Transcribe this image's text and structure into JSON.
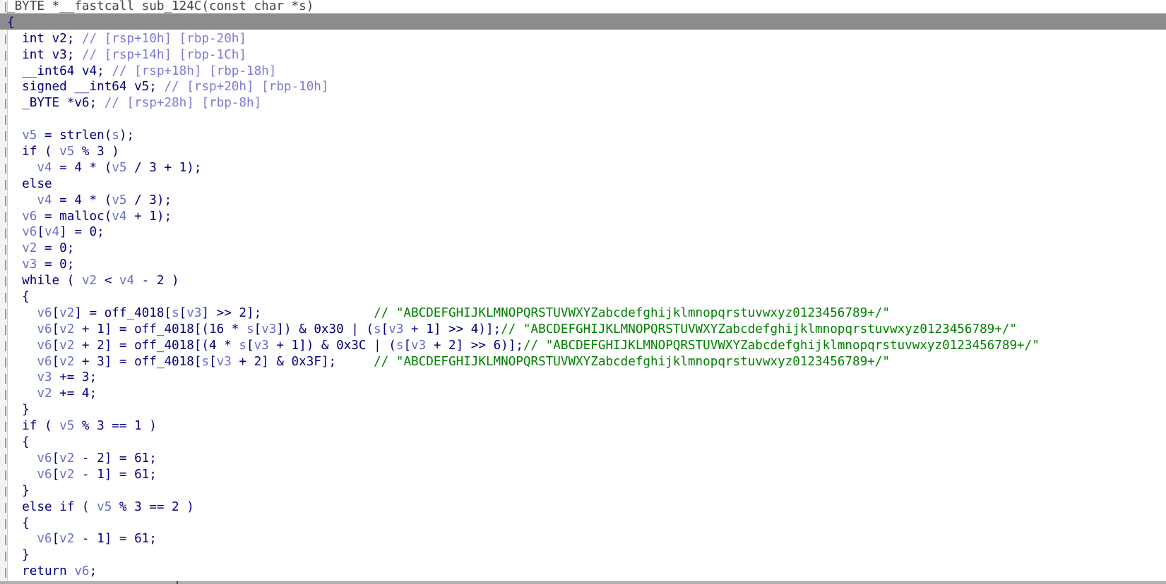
{
  "window": {
    "view": "pseudocode"
  },
  "colors": {
    "keyword": "#000080",
    "variable": "#6670c8",
    "offset_comment": "#7b7bd9",
    "string_comment": "#008000",
    "current_line_bg": "#8c8c8c"
  },
  "code_lines": [
    [
      {
        "t": "_BYTE *__fastcall sub_124C(const char *s)",
        "c": "header"
      }
    ],
    [
      {
        "t": "{",
        "c": "brace-cur"
      }
    ],
    [
      {
        "t": "  int ",
        "c": "kw"
      },
      {
        "t": "v2",
        "c": "kw"
      },
      {
        "t": "; ",
        "c": "punc"
      },
      {
        "t": "// [rsp+10h] [rbp-20h]",
        "c": "comment"
      }
    ],
    [
      {
        "t": "  int ",
        "c": "kw"
      },
      {
        "t": "v3",
        "c": "kw"
      },
      {
        "t": "; ",
        "c": "punc"
      },
      {
        "t": "// [rsp+14h] [rbp-1Ch]",
        "c": "comment"
      }
    ],
    [
      {
        "t": "  __int64 ",
        "c": "kw"
      },
      {
        "t": "v4",
        "c": "kw"
      },
      {
        "t": "; ",
        "c": "punc"
      },
      {
        "t": "// [rsp+18h] [rbp-18h]",
        "c": "comment"
      }
    ],
    [
      {
        "t": "  signed __int64 ",
        "c": "kw"
      },
      {
        "t": "v5",
        "c": "kw"
      },
      {
        "t": "; ",
        "c": "punc"
      },
      {
        "t": "// [rsp+20h] [rbp-10h]",
        "c": "comment"
      }
    ],
    [
      {
        "t": "  _BYTE *",
        "c": "kw"
      },
      {
        "t": "v6",
        "c": "kw"
      },
      {
        "t": "; ",
        "c": "punc"
      },
      {
        "t": "// [rsp+28h] [rbp-8h]",
        "c": "comment"
      }
    ],
    [
      {
        "t": "",
        "c": "punc"
      }
    ],
    [
      {
        "t": "  ",
        "c": "punc"
      },
      {
        "t": "v5",
        "c": "var"
      },
      {
        "t": " = ",
        "c": "punc"
      },
      {
        "t": "strlen",
        "c": "fn"
      },
      {
        "t": "(",
        "c": "punc"
      },
      {
        "t": "s",
        "c": "var"
      },
      {
        "t": ");",
        "c": "punc"
      }
    ],
    [
      {
        "t": "  if ( ",
        "c": "kw"
      },
      {
        "t": "v5",
        "c": "var"
      },
      {
        "t": " % 3 )",
        "c": "punc"
      }
    ],
    [
      {
        "t": "    ",
        "c": "punc"
      },
      {
        "t": "v4",
        "c": "var"
      },
      {
        "t": " = 4 * (",
        "c": "punc"
      },
      {
        "t": "v5",
        "c": "var"
      },
      {
        "t": " / 3 + 1);",
        "c": "punc"
      }
    ],
    [
      {
        "t": "  else",
        "c": "kw"
      }
    ],
    [
      {
        "t": "    ",
        "c": "punc"
      },
      {
        "t": "v4",
        "c": "var"
      },
      {
        "t": " = 4 * (",
        "c": "punc"
      },
      {
        "t": "v5",
        "c": "var"
      },
      {
        "t": " / 3);",
        "c": "punc"
      }
    ],
    [
      {
        "t": "  ",
        "c": "punc"
      },
      {
        "t": "v6",
        "c": "var"
      },
      {
        "t": " = ",
        "c": "punc"
      },
      {
        "t": "malloc",
        "c": "fn"
      },
      {
        "t": "(",
        "c": "punc"
      },
      {
        "t": "v4",
        "c": "var"
      },
      {
        "t": " + 1);",
        "c": "punc"
      }
    ],
    [
      {
        "t": "  ",
        "c": "punc"
      },
      {
        "t": "v6",
        "c": "var"
      },
      {
        "t": "[",
        "c": "punc"
      },
      {
        "t": "v4",
        "c": "var"
      },
      {
        "t": "] = 0;",
        "c": "punc"
      }
    ],
    [
      {
        "t": "  ",
        "c": "punc"
      },
      {
        "t": "v2",
        "c": "var"
      },
      {
        "t": " = 0;",
        "c": "punc"
      }
    ],
    [
      {
        "t": "  ",
        "c": "punc"
      },
      {
        "t": "v3",
        "c": "var"
      },
      {
        "t": " = 0;",
        "c": "punc"
      }
    ],
    [
      {
        "t": "  while ( ",
        "c": "kw"
      },
      {
        "t": "v2",
        "c": "var"
      },
      {
        "t": " < ",
        "c": "punc"
      },
      {
        "t": "v4",
        "c": "var"
      },
      {
        "t": " - 2 )",
        "c": "punc"
      }
    ],
    [
      {
        "t": "  {",
        "c": "punc"
      }
    ],
    [
      {
        "t": "    ",
        "c": "punc"
      },
      {
        "t": "v6",
        "c": "var"
      },
      {
        "t": "[",
        "c": "punc"
      },
      {
        "t": "v2",
        "c": "var"
      },
      {
        "t": "] = ",
        "c": "punc"
      },
      {
        "t": "off_4018",
        "c": "fn"
      },
      {
        "t": "[",
        "c": "punc"
      },
      {
        "t": "s",
        "c": "var"
      },
      {
        "t": "[",
        "c": "punc"
      },
      {
        "t": "v3",
        "c": "var"
      },
      {
        "t": "] >> 2];               ",
        "c": "punc"
      },
      {
        "t": "// \"ABCDEFGHIJKLMNOPQRSTUVWXYZabcdefghijklmnopqrstuvwxyz0123456789+/\"",
        "c": "strcomment"
      }
    ],
    [
      {
        "t": "    ",
        "c": "punc"
      },
      {
        "t": "v6",
        "c": "var"
      },
      {
        "t": "[",
        "c": "punc"
      },
      {
        "t": "v2",
        "c": "var"
      },
      {
        "t": " + 1] = ",
        "c": "punc"
      },
      {
        "t": "off_4018",
        "c": "fn"
      },
      {
        "t": "[(16 * ",
        "c": "punc"
      },
      {
        "t": "s",
        "c": "var"
      },
      {
        "t": "[",
        "c": "punc"
      },
      {
        "t": "v3",
        "c": "var"
      },
      {
        "t": "]) & 0x30 | (",
        "c": "punc"
      },
      {
        "t": "s",
        "c": "var"
      },
      {
        "t": "[",
        "c": "punc"
      },
      {
        "t": "v3",
        "c": "var"
      },
      {
        "t": " + 1] >> 4)];",
        "c": "punc"
      },
      {
        "t": "// \"ABCDEFGHIJKLMNOPQRSTUVWXYZabcdefghijklmnopqrstuvwxyz0123456789+/\"",
        "c": "strcomment"
      }
    ],
    [
      {
        "t": "    ",
        "c": "punc"
      },
      {
        "t": "v6",
        "c": "var"
      },
      {
        "t": "[",
        "c": "punc"
      },
      {
        "t": "v2",
        "c": "var"
      },
      {
        "t": " + 2] = ",
        "c": "punc"
      },
      {
        "t": "off_4018",
        "c": "fn"
      },
      {
        "t": "[(4 * ",
        "c": "punc"
      },
      {
        "t": "s",
        "c": "var"
      },
      {
        "t": "[",
        "c": "punc"
      },
      {
        "t": "v3",
        "c": "var"
      },
      {
        "t": " + 1]) & 0x3C | (",
        "c": "punc"
      },
      {
        "t": "s",
        "c": "var"
      },
      {
        "t": "[",
        "c": "punc"
      },
      {
        "t": "v3",
        "c": "var"
      },
      {
        "t": " + 2] >> 6)];",
        "c": "punc"
      },
      {
        "t": "// \"ABCDEFGHIJKLMNOPQRSTUVWXYZabcdefghijklmnopqrstuvwxyz0123456789+/\"",
        "c": "strcomment"
      }
    ],
    [
      {
        "t": "    ",
        "c": "punc"
      },
      {
        "t": "v6",
        "c": "var"
      },
      {
        "t": "[",
        "c": "punc"
      },
      {
        "t": "v2",
        "c": "var"
      },
      {
        "t": " + 3] = ",
        "c": "punc"
      },
      {
        "t": "off_4018",
        "c": "fn"
      },
      {
        "t": "[",
        "c": "punc"
      },
      {
        "t": "s",
        "c": "var"
      },
      {
        "t": "[",
        "c": "punc"
      },
      {
        "t": "v3",
        "c": "var"
      },
      {
        "t": " + 2] & 0x3F];     ",
        "c": "punc"
      },
      {
        "t": "// \"ABCDEFGHIJKLMNOPQRSTUVWXYZabcdefghijklmnopqrstuvwxyz0123456789+/\"",
        "c": "strcomment"
      }
    ],
    [
      {
        "t": "    ",
        "c": "punc"
      },
      {
        "t": "v3",
        "c": "var"
      },
      {
        "t": " += 3;",
        "c": "punc"
      }
    ],
    [
      {
        "t": "    ",
        "c": "punc"
      },
      {
        "t": "v2",
        "c": "var"
      },
      {
        "t": " += 4;",
        "c": "punc"
      }
    ],
    [
      {
        "t": "  }",
        "c": "punc"
      }
    ],
    [
      {
        "t": "  if ( ",
        "c": "kw"
      },
      {
        "t": "v5",
        "c": "var"
      },
      {
        "t": " % 3 == 1 )",
        "c": "punc"
      }
    ],
    [
      {
        "t": "  {",
        "c": "punc"
      }
    ],
    [
      {
        "t": "    ",
        "c": "punc"
      },
      {
        "t": "v6",
        "c": "var"
      },
      {
        "t": "[",
        "c": "punc"
      },
      {
        "t": "v2",
        "c": "var"
      },
      {
        "t": " - 2] = 61;",
        "c": "punc"
      }
    ],
    [
      {
        "t": "    ",
        "c": "punc"
      },
      {
        "t": "v6",
        "c": "var"
      },
      {
        "t": "[",
        "c": "punc"
      },
      {
        "t": "v2",
        "c": "var"
      },
      {
        "t": " - 1] = 61;",
        "c": "punc"
      }
    ],
    [
      {
        "t": "  }",
        "c": "punc"
      }
    ],
    [
      {
        "t": "  else if ( ",
        "c": "kw"
      },
      {
        "t": "v5",
        "c": "var"
      },
      {
        "t": " % 3 == 2 )",
        "c": "punc"
      }
    ],
    [
      {
        "t": "  {",
        "c": "punc"
      }
    ],
    [
      {
        "t": "    ",
        "c": "punc"
      },
      {
        "t": "v6",
        "c": "var"
      },
      {
        "t": "[",
        "c": "punc"
      },
      {
        "t": "v2",
        "c": "var"
      },
      {
        "t": " - 1] = 61;",
        "c": "punc"
      }
    ],
    [
      {
        "t": "  }",
        "c": "punc"
      }
    ],
    [
      {
        "t": "  return ",
        "c": "kw"
      },
      {
        "t": "v6",
        "c": "var"
      },
      {
        "t": ";",
        "c": "punc"
      }
    ]
  ]
}
